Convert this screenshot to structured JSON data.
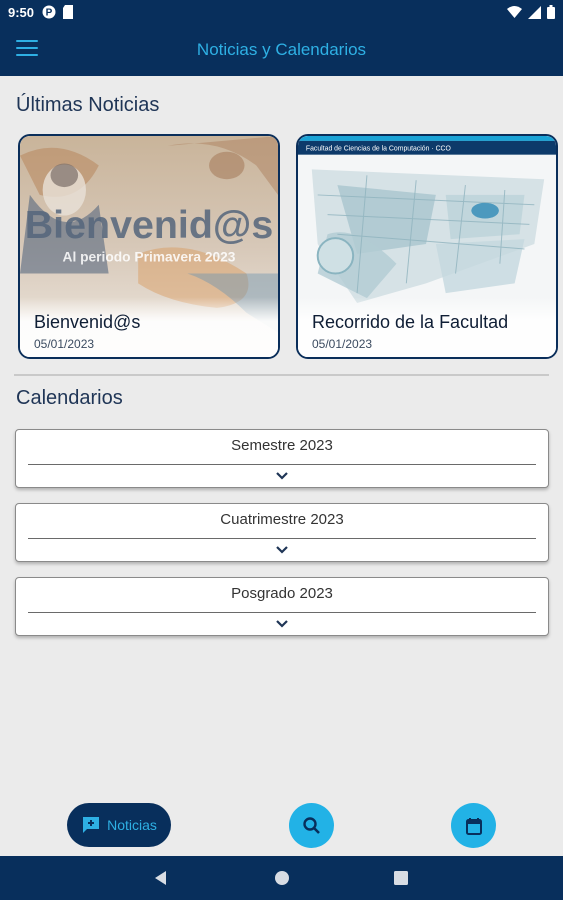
{
  "status_bar": {
    "time": "9:50"
  },
  "app_bar": {
    "title": "Noticias y Calendarios"
  },
  "news": {
    "section_title": "Últimas Noticias",
    "cards": [
      {
        "title": "Bienvenid@s",
        "date": "05/01/2023",
        "banner_heading": "Bienvenid@s",
        "banner_subtitle": "Al periodo Primavera 2023"
      },
      {
        "title": "Recorrido de la Facultad",
        "date": "05/01/2023",
        "map_header": "Facultad de Ciencias de la Computación · CCO"
      }
    ]
  },
  "calendars": {
    "section_title": "Calendarios",
    "items": [
      {
        "label": "Semestre 2023"
      },
      {
        "label": "Cuatrimestre 2023"
      },
      {
        "label": "Posgrado 2023"
      }
    ]
  },
  "bottom_actions": {
    "news_label": "Noticias",
    "search_icon": "search-icon",
    "calendar_icon": "calendar-icon"
  },
  "colors": {
    "primary_dark": "#082f5c",
    "accent": "#2eb0e4",
    "background": "#ebebeb"
  }
}
